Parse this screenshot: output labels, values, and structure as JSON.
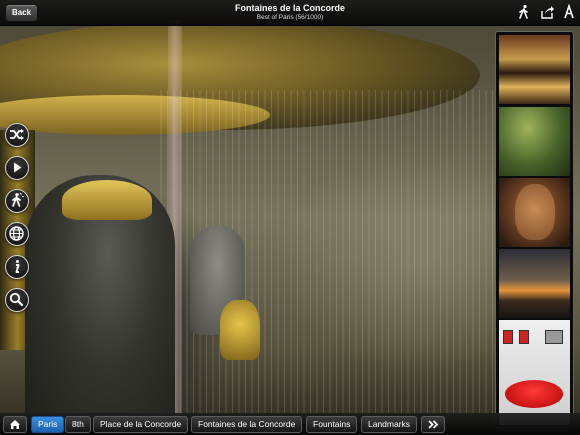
{
  "topbar": {
    "back_label": "Back",
    "title": "Fontaines de la Concorde",
    "subtitle": "Best of Paris (56/1000)",
    "icons": [
      "walking-icon",
      "share-icon",
      "font-size-icon"
    ]
  },
  "left_controls": [
    {
      "name": "shuffle-icon"
    },
    {
      "name": "play-icon"
    },
    {
      "name": "walker-icon"
    },
    {
      "name": "globe-icon"
    },
    {
      "name": "info-icon"
    },
    {
      "name": "search-icon"
    }
  ],
  "thumbnails": [
    {
      "name": "thumb-carousel"
    },
    {
      "name": "thumb-green-wall"
    },
    {
      "name": "thumb-mask"
    },
    {
      "name": "thumb-bridge-sunset"
    },
    {
      "name": "thumb-lips-sofa"
    }
  ],
  "breadcrumbs": {
    "home_icon": "home-icon",
    "items": [
      "Paris",
      "8th",
      "Place de la Concorde",
      "Fontaines de la Concorde",
      "Fountains",
      "Landmarks"
    ],
    "more_icon": "double-chevron-right-icon",
    "active_index": 0
  },
  "colors": {
    "accent": "#2a7ad0",
    "bar": "#111111"
  }
}
